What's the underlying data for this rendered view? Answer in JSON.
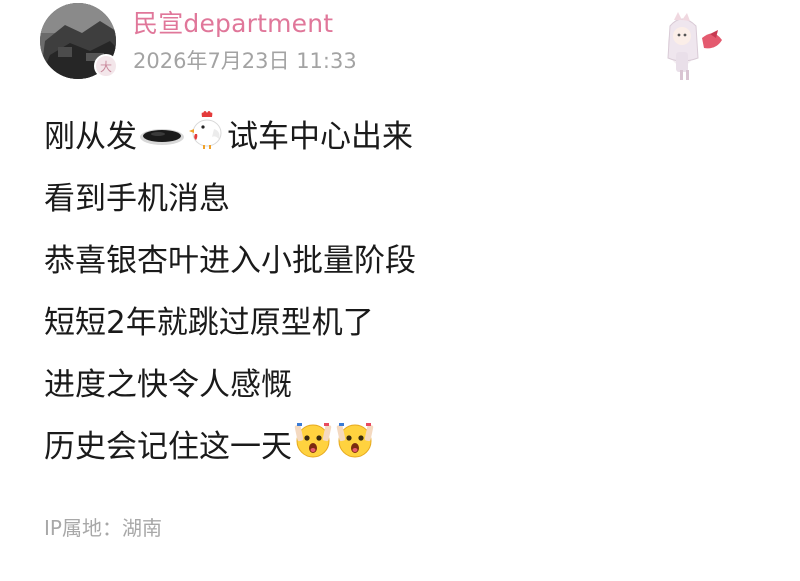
{
  "post": {
    "username": "民宣department",
    "level_badge": "大",
    "timestamp": "2026年7月23日 11:33",
    "decoration": "anime-girl-sticker",
    "lines": [
      {
        "before": "刚从发",
        "icon1": "pothole-icon",
        "icon2": "chicken-icon",
        "after": "试车中心出来"
      },
      {
        "text": "看到手机消息"
      },
      {
        "text": "恭喜银杏叶进入小批量阶段"
      },
      {
        "text": "短短2年就跳过原型机了"
      },
      {
        "text": "进度之快令人感慨"
      },
      {
        "text": "历史会记住这一天",
        "trailing_icons": [
          "shocked-face-icon",
          "shocked-face-icon"
        ]
      }
    ],
    "ip_location": "IP属地：湖南"
  },
  "colors": {
    "username": "#e0779a",
    "meta_gray": "#a3a3a3",
    "text": "#1a1a1a",
    "badge_bg": "#f3e6ea"
  }
}
